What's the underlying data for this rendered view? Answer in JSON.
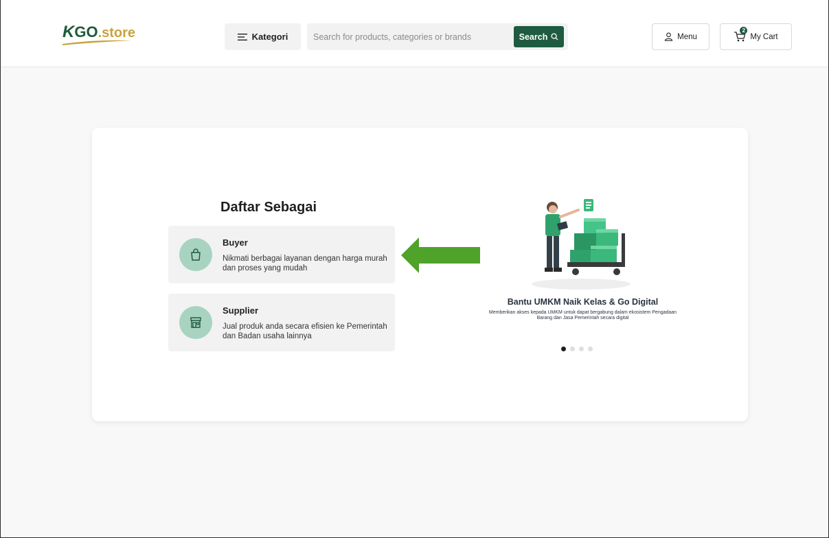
{
  "header": {
    "logo": {
      "k": "K",
      "go": "GO",
      "store": ".store"
    },
    "kategori_label": "Kategori",
    "search": {
      "placeholder": "Search for products, categories or brands",
      "value": "",
      "button_label": "Search"
    },
    "menu_label": "Menu",
    "cart": {
      "label": "My Cart",
      "count": "2"
    }
  },
  "register": {
    "title": "Daftar Sebagai",
    "options": [
      {
        "title": "Buyer",
        "description": "Nikmati berbagai layanan dengan harga murah dan proses yang mudah",
        "icon": "shopping-bag-icon"
      },
      {
        "title": "Supplier",
        "description": "Jual produk anda secara efisien ke Pemerintah dan Badan usaha lainnya",
        "icon": "store-icon"
      }
    ]
  },
  "promo": {
    "title": "Bantu UMKM Naik Kelas & Go Digital",
    "description": "Memberikan akses kepada UMKM untuk dapat bergabung dalam ekosistem Pengadaan Barang dan Jasa Pemerintah secara digital",
    "slides_count": 4,
    "active_slide": 1
  },
  "colors": {
    "brand_green": "#1e5b41",
    "brand_gold": "#c9a23a",
    "icon_circle": "#a9d3c1",
    "arrow_green": "#4fa22a"
  }
}
